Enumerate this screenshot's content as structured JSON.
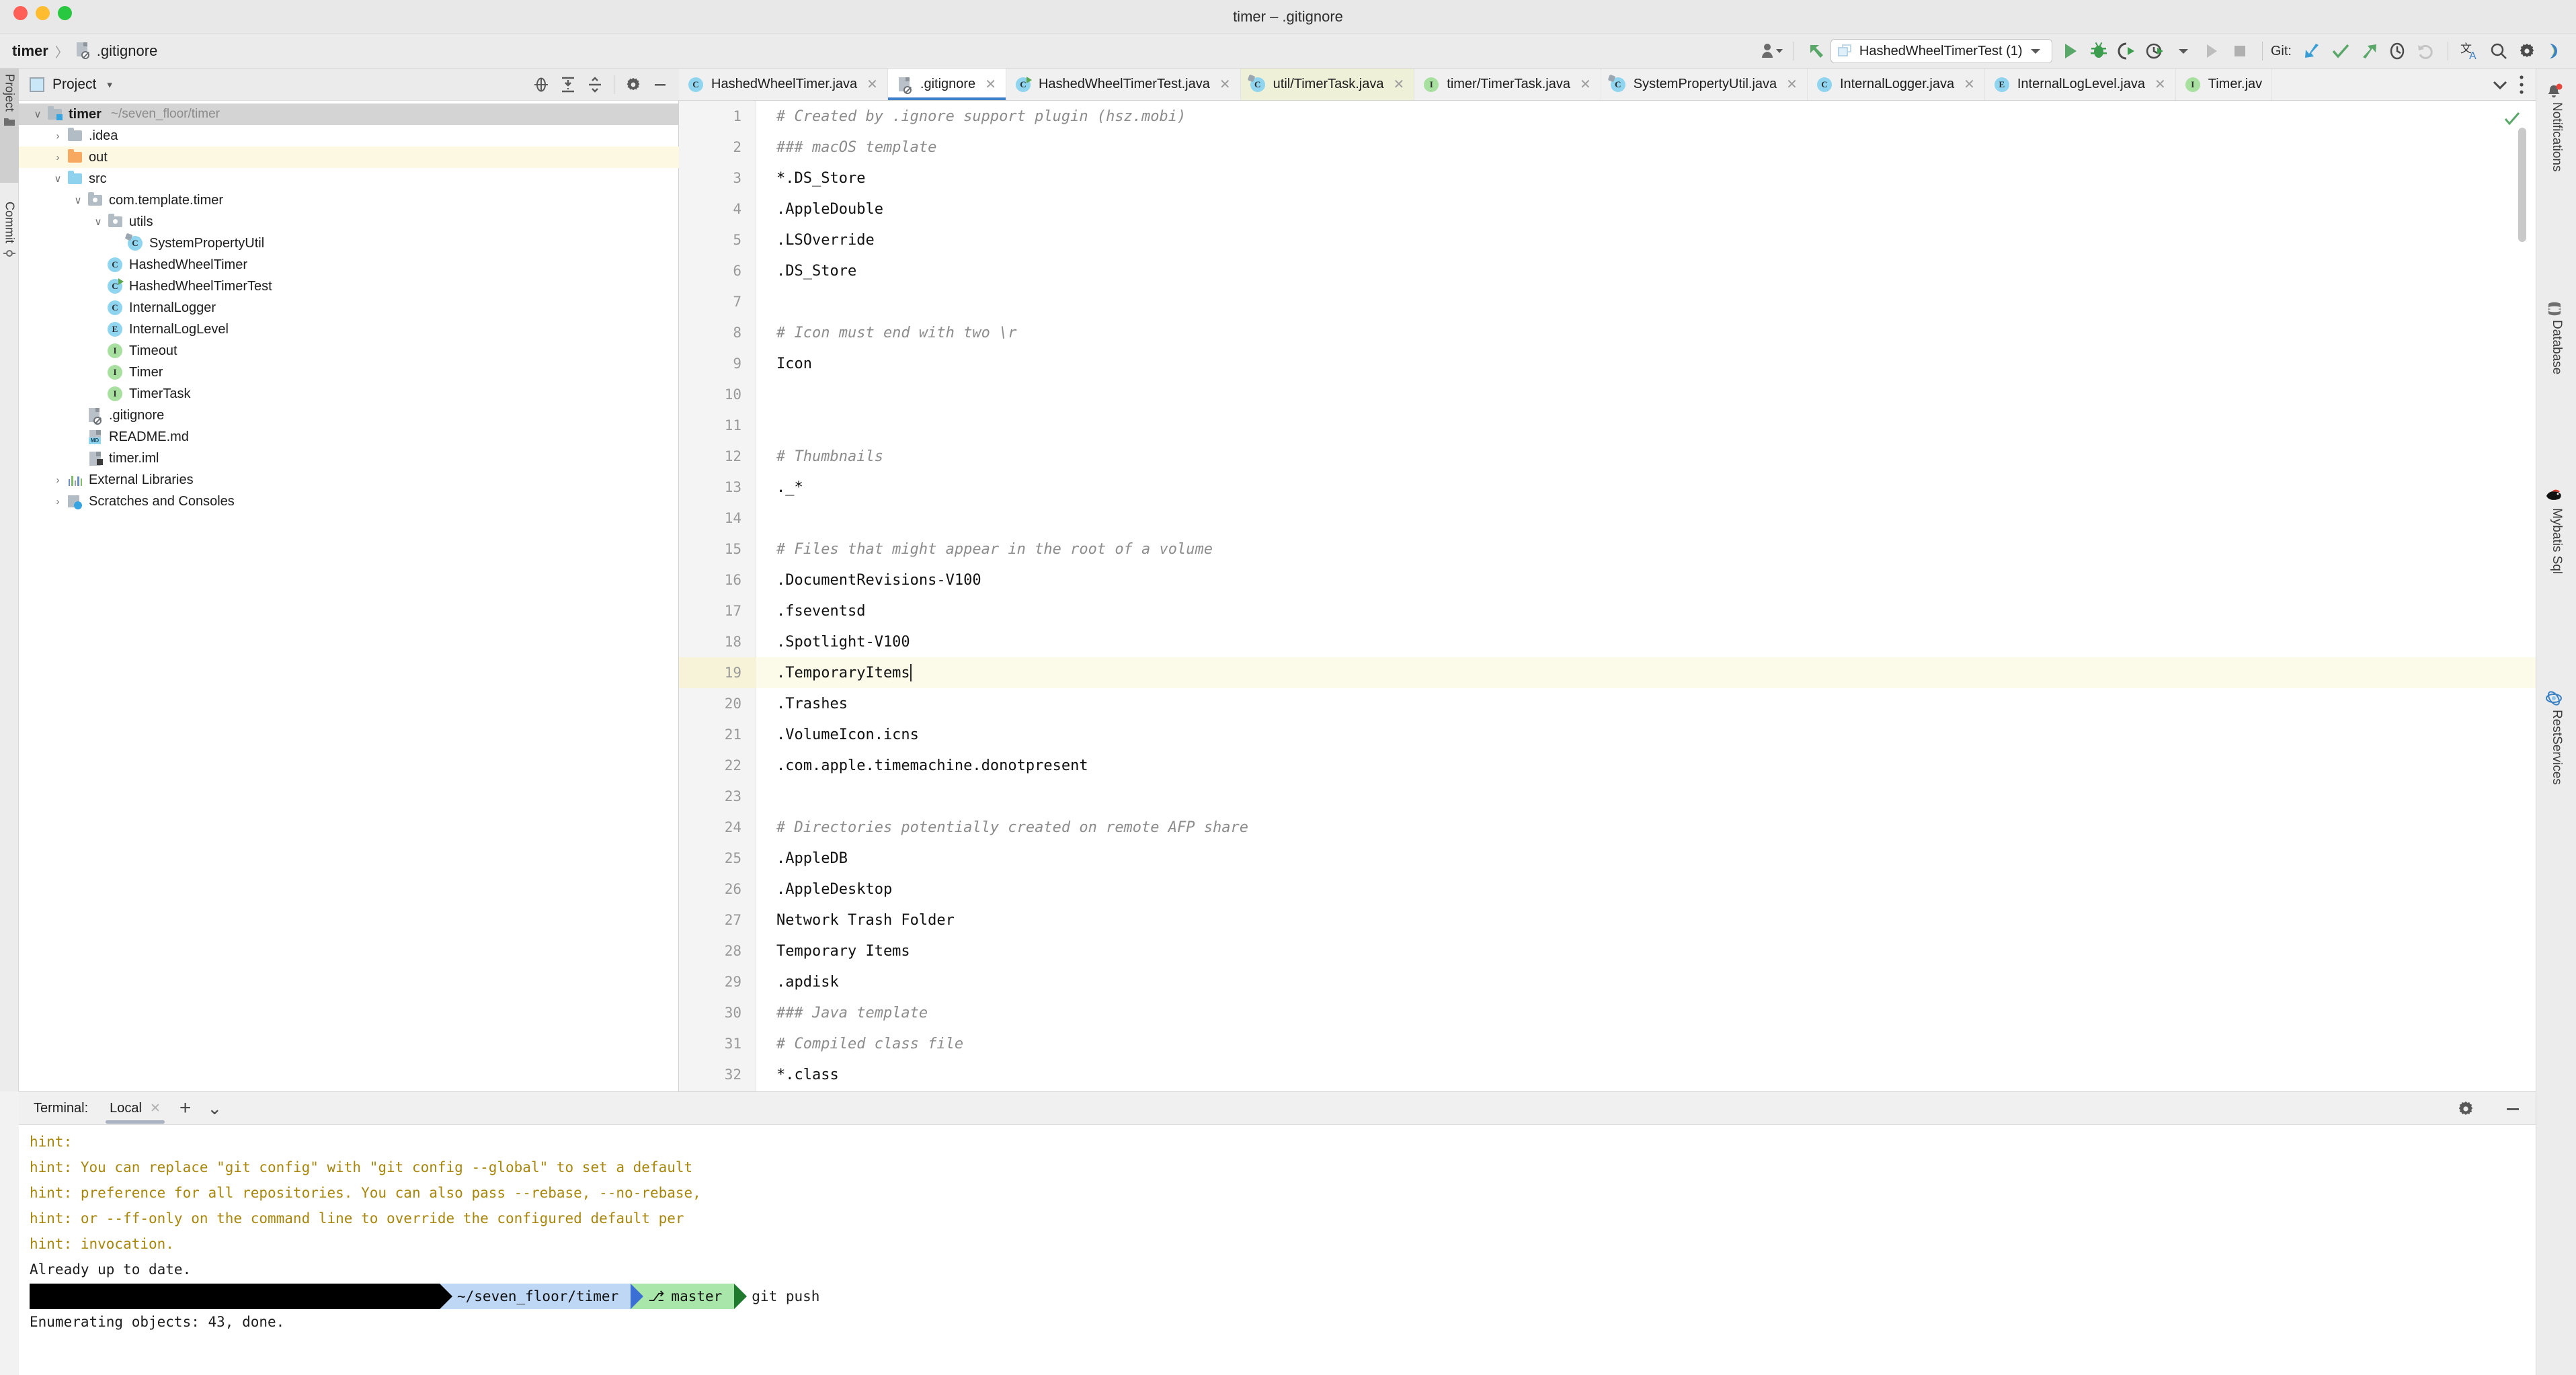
{
  "window": {
    "title": "timer – .gitignore",
    "traffic_lights": [
      "close",
      "minimize",
      "maximize"
    ]
  },
  "navbar": {
    "breadcrumb": {
      "project": "timer",
      "separator": "〉",
      "file": ".gitignore"
    },
    "run_config": {
      "label": "HashedWheelTimerTest (1)",
      "icon": "run-config-icon"
    },
    "git_label": "Git:",
    "icons": [
      "user-avatar-icon",
      "back-arrow-icon",
      "run-icon",
      "debug-icon",
      "run-with-coverage-icon",
      "profile-icon",
      "run-disabled-icon",
      "stop-icon",
      "git-update-icon",
      "git-commit-icon",
      "git-push-icon",
      "git-history-icon",
      "git-rollback-icon",
      "translate-icon",
      "search-everywhere-icon",
      "settings-icon",
      "ide-theme-icon"
    ]
  },
  "left_strip": {
    "tabs": [
      {
        "label": "Project",
        "icon": "project-folder-icon",
        "active": true
      },
      {
        "label": "Commit",
        "icon": "commit-icon",
        "active": false
      }
    ]
  },
  "right_strip": {
    "tabs": [
      {
        "label": "Notifications",
        "icon": "notification-bell-icon"
      },
      {
        "label": "Database",
        "icon": "database-icon"
      },
      {
        "label": "Mybatis Sql",
        "icon": "mybatis-bird-icon"
      },
      {
        "label": "RestServices",
        "icon": "rest-services-icon"
      }
    ]
  },
  "project_panel": {
    "header": {
      "title": "Project",
      "caret": "▾",
      "icons": [
        "select-opened-file-icon",
        "expand-all-icon",
        "collapse-all-icon",
        "gear-icon",
        "hide-icon"
      ]
    },
    "tree": [
      {
        "indent": 0,
        "twisty": "down",
        "icon": "module-folder-icon",
        "label": "timer",
        "path": "~/seven_floor/timer",
        "bold": true,
        "state": "selected"
      },
      {
        "indent": 1,
        "twisty": "right",
        "icon": "folder-gray-icon",
        "label": ".idea",
        "path": "",
        "bold": false,
        "state": ""
      },
      {
        "indent": 1,
        "twisty": "right",
        "icon": "folder-orange-icon",
        "label": "out",
        "path": "",
        "bold": false,
        "state": "highlight"
      },
      {
        "indent": 1,
        "twisty": "down",
        "icon": "folder-source-icon",
        "label": "src",
        "path": "",
        "bold": false,
        "state": ""
      },
      {
        "indent": 2,
        "twisty": "down",
        "icon": "package-icon",
        "label": "com.template.timer",
        "path": "",
        "bold": false,
        "state": ""
      },
      {
        "indent": 3,
        "twisty": "down",
        "icon": "package-icon",
        "label": "utils",
        "path": "",
        "bold": false,
        "state": ""
      },
      {
        "indent": 4,
        "twisty": "",
        "icon": "class-abstract-icon",
        "label": "SystemPropertyUtil",
        "path": "",
        "bold": false,
        "state": ""
      },
      {
        "indent": 3,
        "twisty": "",
        "icon": "class-icon",
        "label": "HashedWheelTimer",
        "path": "",
        "bold": false,
        "state": ""
      },
      {
        "indent": 3,
        "twisty": "",
        "icon": "class-runnable-icon",
        "label": "HashedWheelTimerTest",
        "path": "",
        "bold": false,
        "state": ""
      },
      {
        "indent": 3,
        "twisty": "",
        "icon": "class-icon",
        "label": "InternalLogger",
        "path": "",
        "bold": false,
        "state": ""
      },
      {
        "indent": 3,
        "twisty": "",
        "icon": "enum-icon",
        "label": "InternalLogLevel",
        "path": "",
        "bold": false,
        "state": ""
      },
      {
        "indent": 3,
        "twisty": "",
        "icon": "interface-icon",
        "label": "Timeout",
        "path": "",
        "bold": false,
        "state": ""
      },
      {
        "indent": 3,
        "twisty": "",
        "icon": "interface-icon",
        "label": "Timer",
        "path": "",
        "bold": false,
        "state": ""
      },
      {
        "indent": 3,
        "twisty": "",
        "icon": "interface-icon",
        "label": "TimerTask",
        "path": "",
        "bold": false,
        "state": ""
      },
      {
        "indent": 2,
        "twisty": "",
        "icon": "gitignore-file-icon",
        "label": ".gitignore",
        "path": "",
        "bold": false,
        "state": ""
      },
      {
        "indent": 2,
        "twisty": "",
        "icon": "markdown-file-icon",
        "label": "README.md",
        "path": "",
        "bold": false,
        "state": ""
      },
      {
        "indent": 2,
        "twisty": "",
        "icon": "iml-file-icon",
        "label": "timer.iml",
        "path": "",
        "bold": false,
        "state": ""
      },
      {
        "indent": 1,
        "twisty": "right",
        "icon": "external-libs-icon",
        "label": "External Libraries",
        "path": "",
        "bold": false,
        "state": ""
      },
      {
        "indent": 1,
        "twisty": "right",
        "icon": "scratches-icon",
        "label": "Scratches and Consoles",
        "path": "",
        "bold": false,
        "state": ""
      }
    ]
  },
  "editor_tabs": {
    "tabs": [
      {
        "label": "HashedWheelTimer.java",
        "icon": "class-icon",
        "state": ""
      },
      {
        "label": ".gitignore",
        "icon": "gitignore-file-icon",
        "state": "active"
      },
      {
        "label": "HashedWheelTimerTest.java",
        "icon": "class-runnable-icon",
        "state": ""
      },
      {
        "label": "util/TimerTask.java",
        "icon": "class-abstract-icon",
        "state": "modified"
      },
      {
        "label": "timer/TimerTask.java",
        "icon": "interface-icon",
        "state": ""
      },
      {
        "label": "SystemPropertyUtil.java",
        "icon": "class-abstract-icon",
        "state": ""
      },
      {
        "label": "InternalLogger.java",
        "icon": "class-icon",
        "state": ""
      },
      {
        "label": "InternalLogLevel.java",
        "icon": "enum-icon",
        "state": ""
      },
      {
        "label": "Timer.jav",
        "icon": "interface-icon",
        "state": "clipped"
      }
    ],
    "close_glyph": "✕",
    "overflow_icons": [
      "chevron-down-icon",
      "more-vertical-icon"
    ]
  },
  "editor": {
    "inspection_status": "ok",
    "lines": [
      {
        "n": 1,
        "text": "# Created by .ignore support plugin (hsz.mobi)",
        "comment": true,
        "hl": false
      },
      {
        "n": 2,
        "text": "### macOS template",
        "comment": true,
        "hl": false
      },
      {
        "n": 3,
        "text": "*.DS_Store",
        "comment": false,
        "hl": false
      },
      {
        "n": 4,
        "text": ".AppleDouble",
        "comment": false,
        "hl": false
      },
      {
        "n": 5,
        "text": ".LSOverride",
        "comment": false,
        "hl": false
      },
      {
        "n": 6,
        "text": ".DS_Store",
        "comment": false,
        "hl": false
      },
      {
        "n": 7,
        "text": "",
        "comment": false,
        "hl": false
      },
      {
        "n": 8,
        "text": "# Icon must end with two \\r",
        "comment": true,
        "hl": false
      },
      {
        "n": 9,
        "text": "Icon",
        "comment": false,
        "hl": false
      },
      {
        "n": 10,
        "text": "",
        "comment": false,
        "hl": false
      },
      {
        "n": 11,
        "text": "",
        "comment": false,
        "hl": false
      },
      {
        "n": 12,
        "text": "# Thumbnails",
        "comment": true,
        "hl": false
      },
      {
        "n": 13,
        "text": "._*",
        "comment": false,
        "hl": false
      },
      {
        "n": 14,
        "text": "",
        "comment": false,
        "hl": false
      },
      {
        "n": 15,
        "text": "# Files that might appear in the root of a volume",
        "comment": true,
        "hl": false
      },
      {
        "n": 16,
        "text": ".DocumentRevisions-V100",
        "comment": false,
        "hl": false
      },
      {
        "n": 17,
        "text": ".fseventsd",
        "comment": false,
        "hl": false
      },
      {
        "n": 18,
        "text": ".Spotlight-V100",
        "comment": false,
        "hl": false
      },
      {
        "n": 19,
        "text": ".TemporaryItems",
        "comment": false,
        "hl": true,
        "caret": true
      },
      {
        "n": 20,
        "text": ".Trashes",
        "comment": false,
        "hl": false
      },
      {
        "n": 21,
        "text": ".VolumeIcon.icns",
        "comment": false,
        "hl": false
      },
      {
        "n": 22,
        "text": ".com.apple.timemachine.donotpresent",
        "comment": false,
        "hl": false
      },
      {
        "n": 23,
        "text": "",
        "comment": false,
        "hl": false
      },
      {
        "n": 24,
        "text": "# Directories potentially created on remote AFP share",
        "comment": true,
        "hl": false
      },
      {
        "n": 25,
        "text": ".AppleDB",
        "comment": false,
        "hl": false
      },
      {
        "n": 26,
        "text": ".AppleDesktop",
        "comment": false,
        "hl": false
      },
      {
        "n": 27,
        "text": "Network Trash Folder",
        "comment": false,
        "hl": false
      },
      {
        "n": 28,
        "text": "Temporary Items",
        "comment": false,
        "hl": false
      },
      {
        "n": 29,
        "text": ".apdisk",
        "comment": false,
        "hl": false
      },
      {
        "n": 30,
        "text": "### Java template",
        "comment": true,
        "hl": false
      },
      {
        "n": 31,
        "text": "# Compiled class file",
        "comment": true,
        "hl": false
      },
      {
        "n": 32,
        "text": "*.class",
        "comment": false,
        "hl": false
      }
    ]
  },
  "terminal": {
    "header": {
      "label": "Terminal:",
      "tab": "Local",
      "close_glyph": "✕",
      "add_glyph": "+",
      "list_glyph": "⌄",
      "right_icons": [
        "gear-icon",
        "hide-icon"
      ]
    },
    "output": [
      {
        "text": "hint:",
        "hint": true
      },
      {
        "text": "hint: You can replace \"git config\" with \"git config --global\" to set a default",
        "hint": true
      },
      {
        "text": "hint: preference for all repositories. You can also pass --rebase, --no-rebase,",
        "hint": true
      },
      {
        "text": "hint: or --ff-only on the command line to override the configured default per",
        "hint": true
      },
      {
        "text": "hint: invocation.",
        "hint": true
      },
      {
        "text": "Already up to date.",
        "hint": false
      }
    ],
    "prompt": {
      "path": "~/seven_floor/timer",
      "branch_glyph": "⎇",
      "branch": "master",
      "command": "git push"
    },
    "after_prompt": [
      {
        "text": "Enumerating objects: 43, done.",
        "hint": false
      }
    ]
  }
}
